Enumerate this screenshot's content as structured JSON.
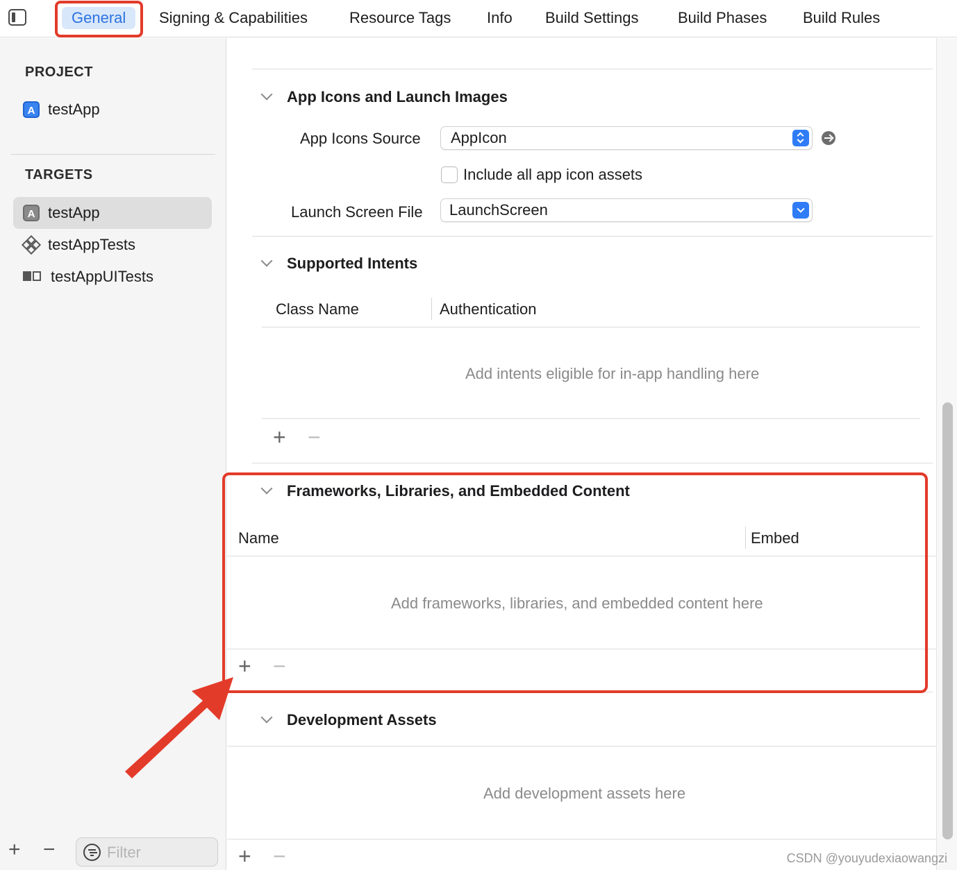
{
  "tabs": [
    {
      "label": "General",
      "active": true
    },
    {
      "label": "Signing & Capabilities"
    },
    {
      "label": "Resource Tags"
    },
    {
      "label": "Info"
    },
    {
      "label": "Build Settings"
    },
    {
      "label": "Build Phases"
    },
    {
      "label": "Build Rules"
    }
  ],
  "sidebar": {
    "project_heading": "PROJECT",
    "project_item": "testApp",
    "targets_heading": "TARGETS",
    "targets": [
      {
        "label": "testApp",
        "selected": true,
        "icon": "app-target-icon"
      },
      {
        "label": "testAppTests",
        "icon": "unit-tests-icon"
      },
      {
        "label": "testAppUITests",
        "icon": "ui-tests-icon"
      }
    ],
    "add": "+",
    "remove": "−",
    "filter_placeholder": "Filter"
  },
  "app_icons_section": {
    "title": "App Icons and Launch Images",
    "icons_source_label": "App Icons Source",
    "icons_source_value": "AppIcon",
    "include_all_label": "Include all app icon assets",
    "launch_screen_label": "Launch Screen File",
    "launch_screen_value": "LaunchScreen"
  },
  "intents_section": {
    "title": "Supported Intents",
    "col_class": "Class Name",
    "col_auth": "Authentication",
    "empty": "Add intents eligible for in-app handling here",
    "add": "+",
    "remove": "−"
  },
  "frameworks_section": {
    "title": "Frameworks, Libraries, and Embedded Content",
    "col_name": "Name",
    "col_embed": "Embed",
    "empty": "Add frameworks, libraries, and embedded content here",
    "add": "+",
    "remove": "−"
  },
  "dev_assets_section": {
    "title": "Development Assets",
    "empty": "Add development assets here",
    "add": "+",
    "remove": "−"
  },
  "colors": {
    "accent": "#2f7cf6",
    "annotation": "#e33b2a"
  },
  "watermark": "CSDN @youyudexiaowangzi"
}
